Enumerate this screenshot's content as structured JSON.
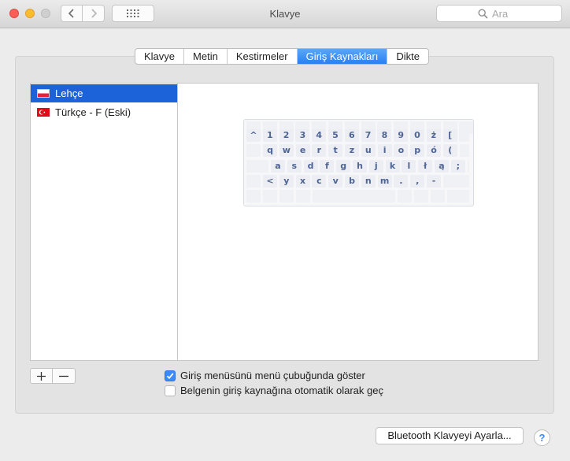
{
  "window": {
    "title": "Klavye"
  },
  "icons": {
    "back": "chevron-left-icon",
    "forward": "chevron-right-icon",
    "grid": "grid-icon",
    "search": "search-icon",
    "add": "plus-icon",
    "remove": "minus-icon",
    "help": "question-icon"
  },
  "colors": {
    "accent": "#2a80f3",
    "selection": "#1c63d9",
    "key_text": "#4f6594"
  },
  "search": {
    "placeholder": "Ara"
  },
  "tabs": [
    {
      "label": "Klavye"
    },
    {
      "label": "Metin"
    },
    {
      "label": "Kestirmeler"
    },
    {
      "label": "Giriş Kaynakları"
    },
    {
      "label": "Dikte"
    }
  ],
  "active_tab": "Giriş Kaynakları",
  "sources": [
    {
      "label": "Lehçe",
      "flag": "poland-flag",
      "selected": true
    },
    {
      "label": "Türkçe - F (Eski)",
      "flag": "turkey-flag",
      "selected": false
    }
  ],
  "keyboard": {
    "rows": [
      [
        "^",
        "1",
        "2",
        "3",
        "4",
        "5",
        "6",
        "7",
        "8",
        "9",
        "0",
        "ż",
        "["
      ],
      [
        "q",
        "w",
        "e",
        "r",
        "t",
        "z",
        "u",
        "i",
        "o",
        "p",
        "ó",
        "("
      ],
      [
        "a",
        "s",
        "d",
        "f",
        "g",
        "h",
        "j",
        "k",
        "l",
        "ł",
        "ą",
        ";"
      ],
      [
        "<",
        "y",
        "x",
        "c",
        "v",
        "b",
        "n",
        "m",
        ".",
        ",",
        "-"
      ]
    ]
  },
  "options": [
    {
      "label": "Giriş menüsünü menü çubuğunda göster",
      "checked": true
    },
    {
      "label": "Belgenin giriş kaynağına otomatik olarak geç",
      "checked": false
    }
  ],
  "buttons": {
    "bluetooth": "Bluetooth Klavyeyi Ayarla...",
    "help": "?"
  }
}
